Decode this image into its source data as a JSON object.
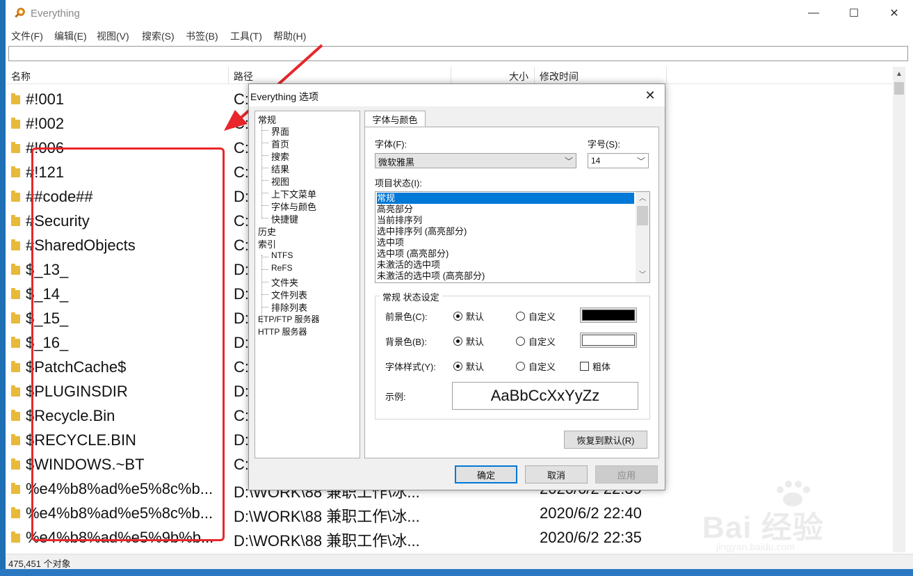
{
  "window": {
    "title": "Everything",
    "min_glyph": "—",
    "max_glyph": "☐",
    "close_glyph": "✕"
  },
  "menu": [
    "文件(F)",
    "编辑(E)",
    "视图(V)",
    "搜索(S)",
    "书签(B)",
    "工具(T)",
    "帮助(H)"
  ],
  "columns": {
    "name": "名称",
    "path": "路径",
    "size": "大小",
    "mtime": "修改时间"
  },
  "rows": [
    {
      "name": "#!001",
      "path": "C:",
      "time": ""
    },
    {
      "name": "#!002",
      "path": "C:",
      "time": ""
    },
    {
      "name": "#!006",
      "path": "C:",
      "time": ""
    },
    {
      "name": "#!121",
      "path": "C:",
      "time": ""
    },
    {
      "name": "##code##",
      "path": "D:",
      "time": ""
    },
    {
      "name": "#Security",
      "path": "C:",
      "time": ""
    },
    {
      "name": "#SharedObjects",
      "path": "C:",
      "time": ""
    },
    {
      "name": "$_13_",
      "path": "D:",
      "time": ""
    },
    {
      "name": "$_14_",
      "path": "D:",
      "time": ""
    },
    {
      "name": "$_15_",
      "path": "D:",
      "time": ""
    },
    {
      "name": "$_16_",
      "path": "D:",
      "time": ""
    },
    {
      "name": "$PatchCache$",
      "path": "C:",
      "time": ""
    },
    {
      "name": "$PLUGINSDIR",
      "path": "D:",
      "time": ""
    },
    {
      "name": "$Recycle.Bin",
      "path": "C:",
      "time": ""
    },
    {
      "name": "$RECYCLE.BIN",
      "path": "D:",
      "time": ""
    },
    {
      "name": "$WINDOWS.~BT",
      "path": "C:",
      "time": ""
    },
    {
      "name": "%e4%b8%ad%e5%8c%b...",
      "path": "D:\\WORK\\88 兼职工作\\冰...",
      "time": "2020/6/2 22:39"
    },
    {
      "name": "%e4%b8%ad%e5%8c%b...",
      "path": "D:\\WORK\\88 兼职工作\\冰...",
      "time": "2020/6/2 22:40"
    },
    {
      "name": "%e4%b8%ad%e5%9b%b...",
      "path": "D:\\WORK\\88 兼职工作\\冰...",
      "time": "2020/6/2 22:35"
    }
  ],
  "status": "475,451 个对象",
  "dialog": {
    "title": "Everything 选项",
    "close_glyph": "✕",
    "tree": {
      "general": "常规",
      "general_children": [
        "界面",
        "首页",
        "搜索",
        "结果",
        "视图",
        "上下文菜单",
        "字体与颜色",
        "快捷键"
      ],
      "history": "历史",
      "index": "索引",
      "index_children": [
        "NTFS",
        "ReFS",
        "文件夹",
        "文件列表",
        "排除列表"
      ],
      "etp": "ETP/FTP 服务器",
      "http": "HTTP 服务器"
    },
    "tab": "字体与颜色",
    "font_label": "字体(F):",
    "font_value": "微软雅黑",
    "size_label": "字号(S):",
    "size_value": "14",
    "state_label": "项目状态(I):",
    "states": [
      "常规",
      "高亮部分",
      "当前排序列",
      "选中排序列 (高亮部分)",
      "选中项",
      "选中项 (高亮部分)",
      "未激活的选中项",
      "未激活的选中项 (高亮部分)"
    ],
    "group_title": "常规 状态设定",
    "fg_label": "前景色(C):",
    "bg_label": "背景色(B):",
    "style_label": "字体样式(Y):",
    "default_label": "默认",
    "custom_label": "自定义",
    "bold_label": "粗体",
    "sample_label": "示例:",
    "sample_text": "AaBbCcXxYyZz",
    "restore_button": "恢复到默认(R)",
    "ok_button": "确定",
    "cancel_button": "取消",
    "apply_button": "应用",
    "fg_color": "#000000",
    "bg_color": "#ffffff"
  },
  "watermark": {
    "brand": "Bai 经验",
    "url": "jingyan.baidu.com"
  },
  "colors": {
    "accent": "#0078d7",
    "annotation": "#e8262b",
    "folder": "#e8b93b"
  }
}
